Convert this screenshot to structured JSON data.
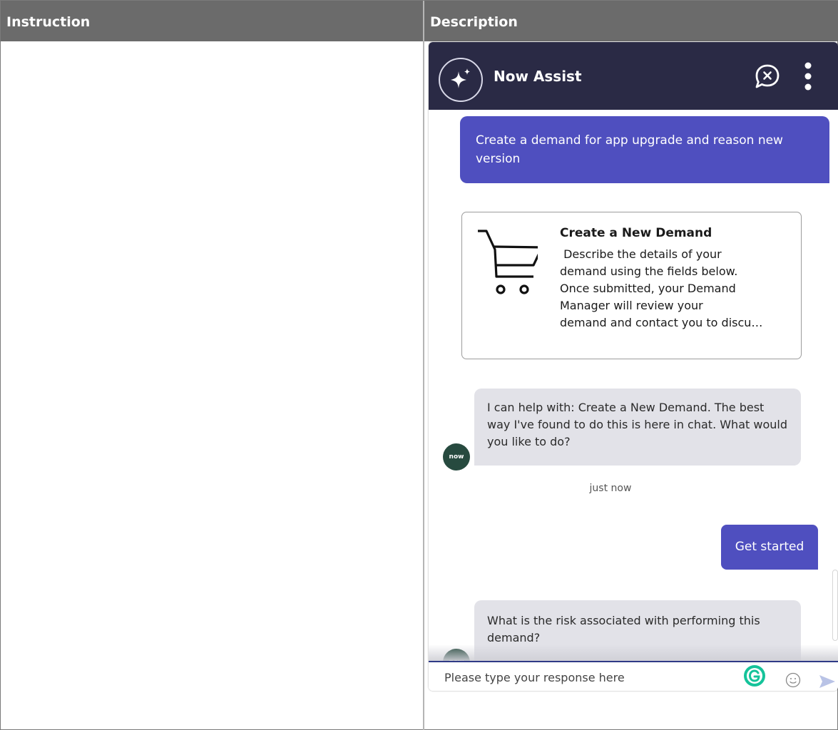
{
  "table": {
    "header_instruction": "Instruction",
    "header_description": "Description"
  },
  "chat": {
    "title": "Now Assist",
    "header_icons": [
      "sparkle-logo-icon",
      "end-chat-icon",
      "more-options-icon"
    ],
    "user_message_1": "Create a demand for app upgrade and reason new version",
    "card": {
      "title": "Create a New Demand",
      "description_lines": [
        " Describe the details of your",
        "demand using the fields below.",
        "Once submitted, your Demand",
        "Manager will review your",
        "demand and contact you to discu…"
      ],
      "icon": "shopping-cart-icon"
    },
    "bot_message_1": "I can help with: Create a New Demand. The best way I've found to do this is here in chat. What would you like to do?",
    "bot_avatar_text": "now",
    "timestamp": "just now",
    "user_message_2": "Get started",
    "bot_message_2": "What is the risk associated with performing this demand?",
    "input_placeholder": "Please type your response here",
    "input_icons": [
      "grammarly-icon",
      "emoji-icon",
      "send-icon"
    ]
  },
  "colors": {
    "header_bg": "#2a2a45",
    "user_bubble": "#4f4fbf",
    "bot_bubble": "#e2e2e8",
    "avatar": "#274a3f",
    "table_header": "#6b6b6b",
    "grammarly": "#15c39a"
  }
}
